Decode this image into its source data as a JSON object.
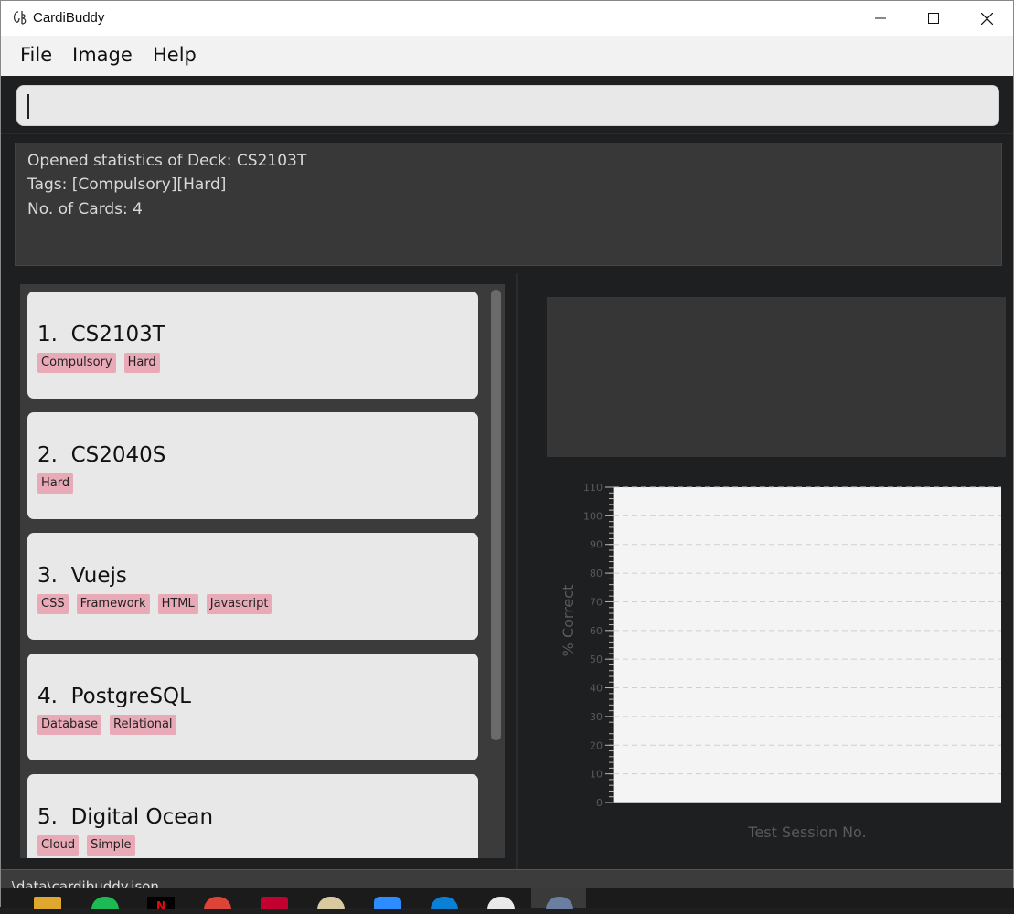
{
  "window": {
    "title": "CardiBuddy"
  },
  "menu": {
    "items": [
      "File",
      "Image",
      "Help"
    ]
  },
  "command": {
    "value": "",
    "placeholder": ""
  },
  "result": {
    "lines": [
      "Opened statistics of Deck: CS2103T",
      "Tags: [Compulsory][Hard]",
      "No. of Cards: 4"
    ]
  },
  "decks": [
    {
      "index": "1.",
      "name": "CS2103T",
      "tags": [
        "Compulsory",
        "Hard"
      ]
    },
    {
      "index": "2.",
      "name": "CS2040S",
      "tags": [
        "Hard"
      ]
    },
    {
      "index": "3.",
      "name": "Vuejs",
      "tags": [
        "CSS",
        "Framework",
        "HTML",
        "Javascript"
      ]
    },
    {
      "index": "4.",
      "name": "PostgreSQL",
      "tags": [
        "Database",
        "Relational"
      ]
    },
    {
      "index": "5.",
      "name": "Digital Ocean",
      "tags": [
        "Cloud",
        "Simple"
      ]
    }
  ],
  "status": {
    "path": ".\\data\\cardibuddy.json"
  },
  "colors": {
    "tag": "#e8aab6",
    "card": "#e8e8e8",
    "panel": "#3b3b3b",
    "background": "#1e1f21"
  },
  "chart_data": {
    "type": "line",
    "title": "",
    "xlabel": "Test Session No.",
    "ylabel": "% Correct",
    "ylim": [
      0,
      110
    ],
    "yticks": [
      0,
      10,
      20,
      30,
      40,
      50,
      60,
      70,
      80,
      90,
      100,
      110
    ],
    "series": [],
    "grid": true
  },
  "taskbar": {
    "icons": [
      "file-explorer-icon",
      "spotify-icon",
      "netflix-icon",
      "chrome-icon",
      "angular-icon",
      "paint-icon",
      "zoom-icon",
      "edge-icon",
      "app-icon",
      "cardibuddy-icon"
    ]
  }
}
